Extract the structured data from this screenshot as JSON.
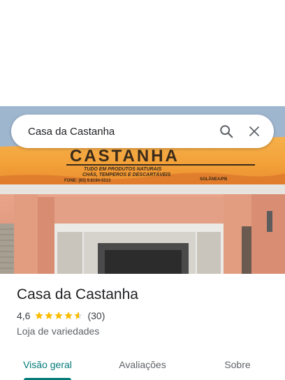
{
  "search": {
    "query": "Casa da Castanha"
  },
  "photo": {
    "sign_title": "CASTANHA",
    "sign_line1": "TUDO EM PRODUTOS NATURAIS",
    "sign_line2": "CHÁS, TEMPEROS E DESCARTÁVEIS",
    "sign_phone": "FONE: (83) 9.8194-5513",
    "sign_city": "SOLÂNEA/PB"
  },
  "place": {
    "name": "Casa da Castanha",
    "rating": "4,6",
    "stars_value": 4.6,
    "review_count": "(30)",
    "category": "Loja de variedades"
  },
  "tabs": [
    {
      "label": "Visão geral",
      "active": true
    },
    {
      "label": "Avaliações",
      "active": false
    },
    {
      "label": "Sobre",
      "active": false
    }
  ],
  "colors": {
    "accent": "#007a78",
    "star": "#fbbc04"
  }
}
